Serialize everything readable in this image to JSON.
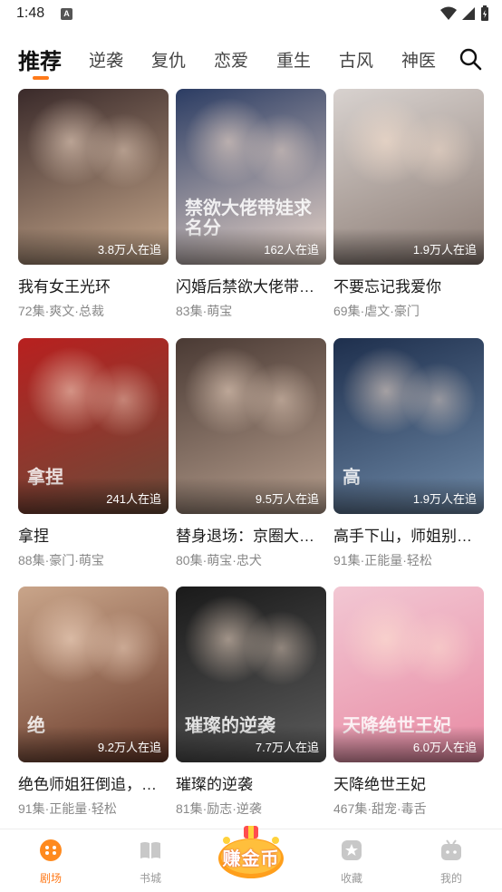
{
  "status": {
    "time": "1:48",
    "notification_badge": "A",
    "colors": {
      "icons": "#333333"
    }
  },
  "tabs": [
    {
      "label": "推荐",
      "active": true
    },
    {
      "label": "逆袭"
    },
    {
      "label": "复仇"
    },
    {
      "label": "恋爱"
    },
    {
      "label": "重生"
    },
    {
      "label": "古风"
    },
    {
      "label": "神医"
    }
  ],
  "accent_color": "#ff7a1a",
  "dramas": [
    {
      "title": "我有女王光环",
      "meta": "72集·爽文·总裁",
      "watchers": "3.8万人在追",
      "poster_colors": [
        "#3a2a2a",
        "#c7a88c"
      ]
    },
    {
      "title": "闪婚后禁欲大佬带…",
      "meta": "83集·萌宝",
      "watchers": "162人在追",
      "poster_colors": [
        "#2b3c63",
        "#e9d5c9"
      ],
      "poster_text": "禁欲大佬带娃求名分"
    },
    {
      "title": "不要忘记我爱你",
      "meta": "69集·虐文·豪门",
      "watchers": "1.9万人在追",
      "poster_colors": [
        "#d8d2cf",
        "#8a7a72"
      ]
    },
    {
      "title": "拿捏",
      "meta": "88集·豪门·萌宝",
      "watchers": "241人在追",
      "poster_colors": [
        "#b8201f",
        "#6a4c3a"
      ],
      "poster_text": "拿捏"
    },
    {
      "title": "替身退场：京圈大…",
      "meta": "80集·萌宝·忠犬",
      "watchers": "9.5万人在追",
      "poster_colors": [
        "#4a3a34",
        "#b79f8e"
      ]
    },
    {
      "title": "高手下山，师姐别…",
      "meta": "91集·正能量·轻松",
      "watchers": "1.9万人在追",
      "poster_colors": [
        "#1e2f4d",
        "#6f8aa8"
      ],
      "poster_text": "高"
    },
    {
      "title": "绝色师姐狂倒追，…",
      "meta": "91集·正能量·轻松",
      "watchers": "9.2万人在追",
      "poster_colors": [
        "#c9a58a",
        "#6a3a2a"
      ],
      "poster_text": "绝"
    },
    {
      "title": "璀璨的逆袭",
      "meta": "81集·励志·逆袭",
      "watchers": "7.7万人在追",
      "poster_colors": [
        "#1a1a1a",
        "#5c5c5c"
      ],
      "poster_text": "璀璨的逆袭"
    },
    {
      "title": "天降绝世王妃",
      "meta": "467集·甜宠·毒舌",
      "watchers": "6.0万人在追",
      "poster_colors": [
        "#f2c7d3",
        "#e88aa3"
      ],
      "poster_text": "天降绝世王妃"
    }
  ],
  "bottom_nav": {
    "items": [
      {
        "label": "剧场",
        "icon": "theater-icon",
        "active": true
      },
      {
        "label": "书城",
        "icon": "book-icon"
      },
      {
        "label": "收藏",
        "icon": "star-icon"
      },
      {
        "label": "我的",
        "icon": "profile-icon"
      }
    ],
    "earn_label": "赚金币"
  }
}
